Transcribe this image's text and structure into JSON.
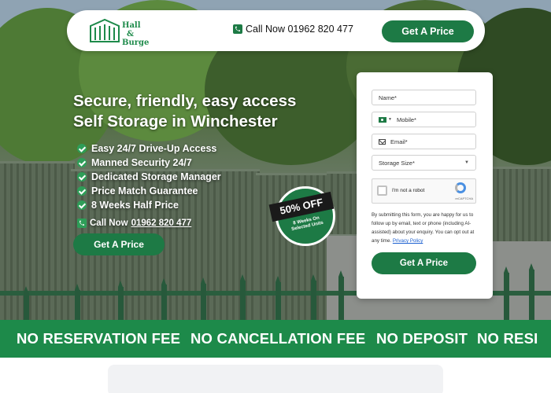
{
  "header": {
    "logo_text": "Hall & Burge",
    "logo_line1": "Hall",
    "logo_line2": "&",
    "logo_line3": "Burge",
    "call_label": "Call Now 01962 820 477",
    "cta_label": "Get A Price"
  },
  "hero": {
    "headline_line1": "Secure, friendly, easy access",
    "headline_line2": "Self Storage in Winchester",
    "features": [
      "Easy 24/7 Drive-Up Access",
      "Manned Security 24/7",
      "Dedicated Storage Manager",
      "Price Match Guarantee",
      "8 Weeks Half Price"
    ],
    "call_prefix": "Call Now",
    "call_number": "01962 820 477",
    "cta_label": "Get A Price"
  },
  "badge": {
    "headline": "50% OFF",
    "subtext": "8 Weeks On Selected Units"
  },
  "form": {
    "name_placeholder": "Name*",
    "mobile_placeholder": "Mobile*",
    "email_placeholder": "Email*",
    "storage_size_placeholder": "Storage Size*",
    "captcha_label": "I'm not a robot",
    "captcha_brand": "reCAPTCHA",
    "disclaimer": "By submitting this form, you are happy for us to follow up by email, text or phone (including AI-assisted) about your enquiry. You can opt out at any time.",
    "privacy_link": "Privacy Policy",
    "submit_label": "Get A Price"
  },
  "banner": {
    "items": [
      "NO RESERVATION FEE",
      "NO CANCELLATION FEE",
      "NO DEPOSIT",
      "NO RESI"
    ]
  },
  "colors": {
    "brand_green": "#1d7a45",
    "banner_green": "#1d8a4a",
    "check_green": "#2e9e58"
  },
  "icons": {
    "phone": "phone-icon",
    "check": "check-circle-icon",
    "email": "envelope-icon",
    "flag": "uk-flag-icon",
    "dropdown": "chevron-down-icon",
    "captcha": "recaptcha-icon"
  }
}
